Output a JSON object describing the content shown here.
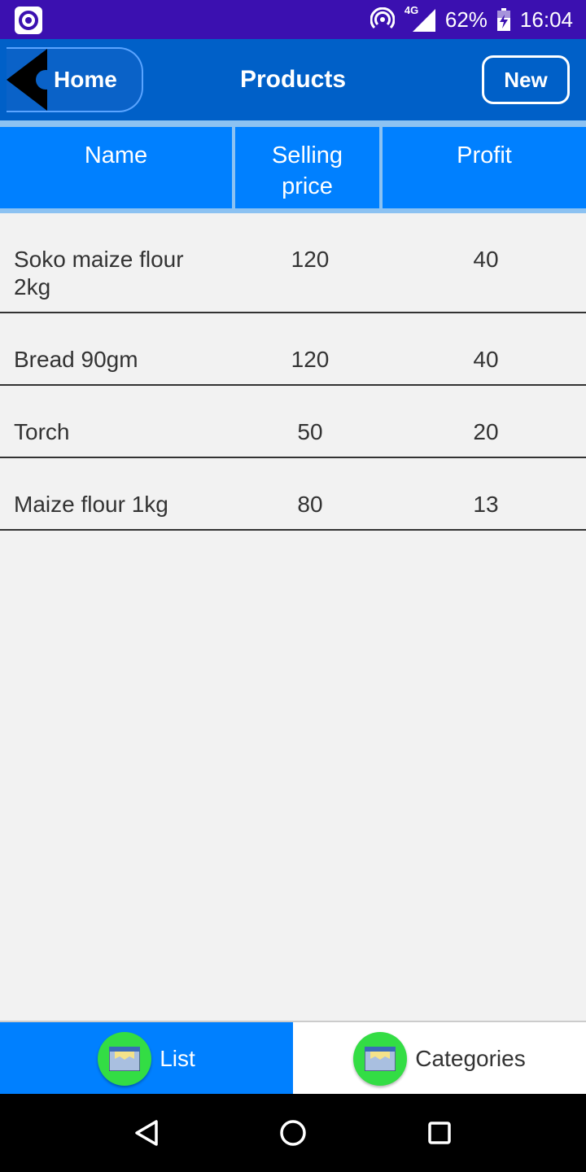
{
  "status_bar": {
    "app_icon": "target-app-icon",
    "hotspot_icon": "hotspot-icon",
    "network_label": "4G",
    "signal_icon": "signal-icon",
    "battery_percent": "62%",
    "battery_icon": "battery-charging-icon",
    "time": "16:04"
  },
  "app_bar": {
    "home_label": "Home",
    "back_icon": "back-arrow-icon",
    "title": "Products",
    "new_label": "New",
    "colors": {
      "bar": "#0060c8",
      "accent": "#0080ff"
    }
  },
  "table": {
    "headers": [
      "Name",
      "Selling price",
      "Profit"
    ],
    "rows": [
      {
        "name": "Soko maize flour 2kg",
        "price": "120",
        "profit": "40"
      },
      {
        "name": "Bread 90gm",
        "price": "120",
        "profit": "40"
      },
      {
        "name": "Torch",
        "price": "50",
        "profit": "20"
      },
      {
        "name": "Maize flour 1kg",
        "price": "80",
        "profit": "13"
      }
    ]
  },
  "tabs": [
    {
      "label": "List",
      "icon": "folder-list-icon",
      "active": true
    },
    {
      "label": "Categories",
      "icon": "folder-categories-icon",
      "active": false
    }
  ],
  "nav_bar": {
    "back_icon": "nav-back-icon",
    "home_icon": "nav-home-icon",
    "recents_icon": "nav-recents-icon"
  }
}
